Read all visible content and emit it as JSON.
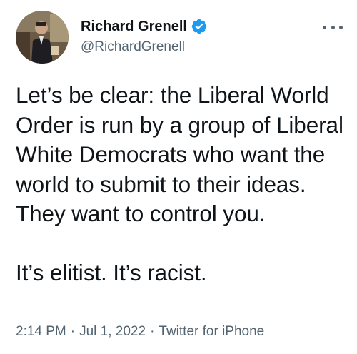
{
  "author": {
    "display_name": "Richard Grenell",
    "handle": "@RichardGrenell",
    "verified": true,
    "verified_color": "#1d9bf0"
  },
  "menu": {
    "icon": "more-horizontal-icon"
  },
  "tweet": {
    "paragraphs": [
      "Let’s be clear: the Liberal World Order is run by a group of Liberal White Democrats who want the world to submit to their ideas. They want to control you.",
      "It’s elitist. It’s racist."
    ]
  },
  "meta": {
    "time": "2:14 PM",
    "separator": "·",
    "date": "Jul 1, 2022",
    "source": "Twitter for iPhone"
  },
  "colors": {
    "text_primary": "#0f1419",
    "text_secondary": "#536471",
    "background": "#ffffff"
  }
}
